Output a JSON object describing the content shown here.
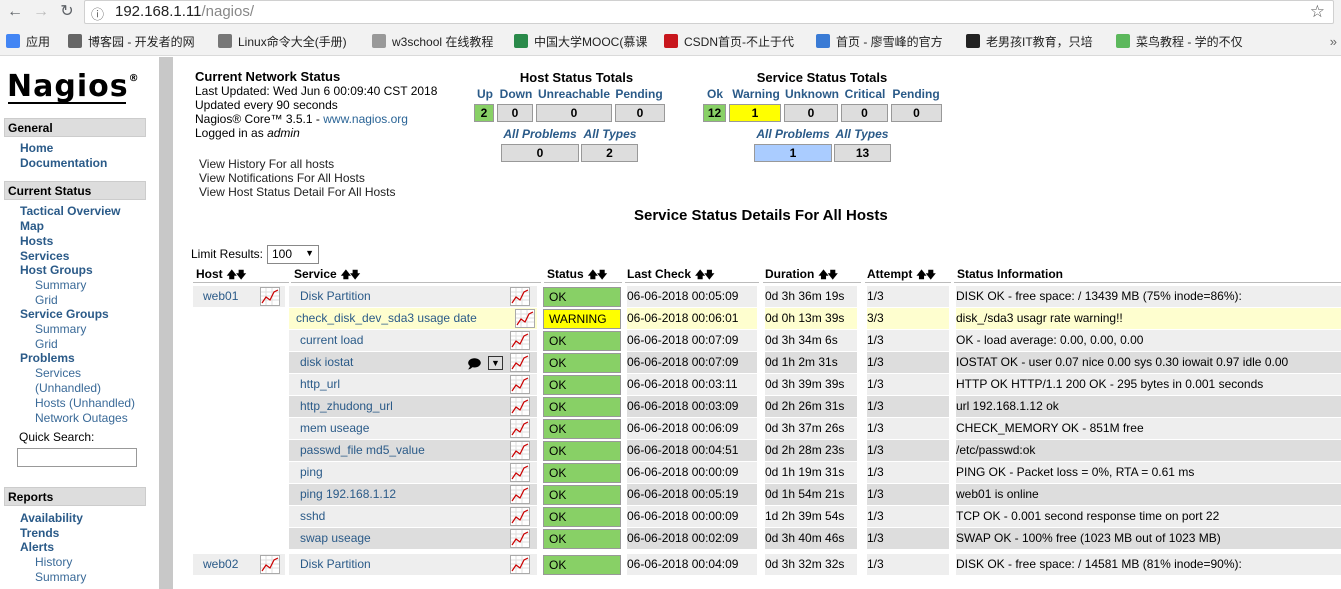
{
  "browser": {
    "url_host": "192.168.1.11",
    "url_path": "/nagios/",
    "bookmarks": [
      {
        "label": "应用",
        "color": "#4285f4"
      },
      {
        "label": "博客园 - 开发者的网",
        "color": "#666666"
      },
      {
        "label": "Linux命令大全(手册)",
        "color": "#777777"
      },
      {
        "label": "w3school 在线教程",
        "color": "#999999"
      },
      {
        "label": "中国大学MOOC(慕课",
        "color": "#2a8a4a"
      },
      {
        "label": "CSDN首页-不止于代",
        "color": "#c8161d"
      },
      {
        "label": "首页 - 廖雪峰的官方",
        "color": "#3a7bd5"
      },
      {
        "label": "老男孩IT教育，只培",
        "color": "#222222"
      },
      {
        "label": "菜鸟教程 - 学的不仅",
        "color": "#5cb85c"
      }
    ]
  },
  "sidebar": {
    "logo": "Nagios",
    "logo_mark": "®",
    "general": "General",
    "general_items": [
      "Home",
      "Documentation"
    ],
    "current_status": "Current Status",
    "cs_items": {
      "tactical": "Tactical Overview",
      "map": "Map",
      "hosts": "Hosts",
      "services": "Services",
      "host_groups": "Host Groups",
      "hg_summary": "Summary",
      "hg_grid": "Grid",
      "service_groups": "Service Groups",
      "sg_summary": "Summary",
      "sg_grid": "Grid",
      "problems": "Problems",
      "p_services": "Services",
      "p_services_unh": "(Unhandled)",
      "p_hosts": "Hosts (Unhandled)",
      "p_outages": "Network Outages"
    },
    "quick_search_label": "Quick Search:",
    "reports": "Reports",
    "report_items": {
      "availability": "Availability",
      "trends": "Trends",
      "alerts": "Alerts",
      "history": "History",
      "summary": "Summary"
    }
  },
  "status_header": {
    "title": "Current Network Status",
    "last_updated": "Last Updated: Wed Jun 6 00:09:40 CST 2018",
    "interval": "Updated every 90 seconds",
    "core": "Nagios® Core™ 3.5.1 - ",
    "core_link": "www.nagios.org",
    "logged_prefix": "Logged in as ",
    "user": "admin",
    "links": [
      "View History For all hosts",
      "View Notifications For All Hosts",
      "View Host Status Detail For All Hosts"
    ]
  },
  "host_totals": {
    "title": "Host Status Totals",
    "headers": [
      "Up",
      "Down",
      "Unreachable",
      "Pending"
    ],
    "values": [
      "2",
      "0",
      "0",
      "0"
    ],
    "sub_headers": [
      "All Problems",
      "All Types"
    ],
    "sub_values": [
      "0",
      "2"
    ]
  },
  "service_totals": {
    "title": "Service Status Totals",
    "headers": [
      "Ok",
      "Warning",
      "Unknown",
      "Critical",
      "Pending"
    ],
    "values": [
      "12",
      "1",
      "0",
      "0",
      "0"
    ],
    "sub_headers": [
      "All Problems",
      "All Types"
    ],
    "sub_values": [
      "1",
      "13"
    ]
  },
  "service_details": {
    "title": "Service Status Details For All Hosts",
    "limit_label": "Limit Results:",
    "limit_value": "100",
    "columns": [
      "Host",
      "Service",
      "Status",
      "Last Check",
      "Duration",
      "Attempt",
      "Status Information"
    ],
    "rows": [
      {
        "host": "web01",
        "service": "Disk Partition",
        "status": "OK",
        "last_check": "06-06-2018 00:05:09",
        "duration": "0d 3h 36m 19s",
        "attempt": "1/3",
        "info": "DISK OK - free space: / 13439 MB (75% inode=86%):"
      },
      {
        "host": "",
        "service": "check_disk_dev_sda3 usage date",
        "status": "WARNING",
        "last_check": "06-06-2018 00:06:01",
        "duration": "0d 0h 13m 39s",
        "attempt": "3/3",
        "info": "disk_/sda3 usagr rate warning!!"
      },
      {
        "host": "",
        "service": "current load",
        "status": "OK",
        "last_check": "06-06-2018 00:07:09",
        "duration": "0d 3h 34m 6s",
        "attempt": "1/3",
        "info": "OK - load average: 0.00, 0.00, 0.00"
      },
      {
        "host": "",
        "service": "disk iostat",
        "status": "OK",
        "last_check": "06-06-2018 00:07:09",
        "duration": "0d 1h 2m 31s",
        "attempt": "1/3",
        "info": "IOSTAT OK - user 0.07 nice 0.00 sys 0.30 iowait 0.97 idle 0.00"
      },
      {
        "host": "",
        "service": "http_url",
        "status": "OK",
        "last_check": "06-06-2018 00:03:11",
        "duration": "0d 3h 39m 39s",
        "attempt": "1/3",
        "info": "HTTP OK HTTP/1.1 200 OK - 295 bytes in 0.001 seconds"
      },
      {
        "host": "",
        "service": "http_zhudong_url",
        "status": "OK",
        "last_check": "06-06-2018 00:03:09",
        "duration": "0d 2h 26m 31s",
        "attempt": "1/3",
        "info": "url 192.168.1.12 ok"
      },
      {
        "host": "",
        "service": "mem useage",
        "status": "OK",
        "last_check": "06-06-2018 00:06:09",
        "duration": "0d 3h 37m 26s",
        "attempt": "1/3",
        "info": "CHECK_MEMORY OK - 851M free"
      },
      {
        "host": "",
        "service": "passwd_file md5_value",
        "status": "OK",
        "last_check": "06-06-2018 00:04:51",
        "duration": "0d 2h 28m 23s",
        "attempt": "1/3",
        "info": "/etc/passwd:ok"
      },
      {
        "host": "",
        "service": "ping",
        "status": "OK",
        "last_check": "06-06-2018 00:00:09",
        "duration": "0d 1h 19m 31s",
        "attempt": "1/3",
        "info": "PING OK - Packet loss = 0%, RTA = 0.61 ms"
      },
      {
        "host": "",
        "service": "ping 192.168.1.12",
        "status": "OK",
        "last_check": "06-06-2018 00:05:19",
        "duration": "0d 1h 54m 21s",
        "attempt": "1/3",
        "info": "web01 is online"
      },
      {
        "host": "",
        "service": "sshd",
        "status": "OK",
        "last_check": "06-06-2018 00:00:09",
        "duration": "1d 2h 39m 54s",
        "attempt": "1/3",
        "info": "TCP OK - 0.001 second response time on port 22"
      },
      {
        "host": "",
        "service": "swap useage",
        "status": "OK",
        "last_check": "06-06-2018 00:02:09",
        "duration": "0d 3h 40m 46s",
        "attempt": "1/3",
        "info": "SWAP OK - 100% free (1023 MB out of 1023 MB)"
      },
      {
        "host": "web02",
        "service": "Disk Partition",
        "status": "OK",
        "last_check": "06-06-2018 00:04:09",
        "duration": "0d 3h 32m 32s",
        "attempt": "1/3",
        "info": "DISK OK - free space: / 14581 MB (81% inode=90%):"
      }
    ]
  },
  "colors": {
    "ok": "#88d066",
    "warning": "#ffff00",
    "link": "#2a5a88"
  }
}
